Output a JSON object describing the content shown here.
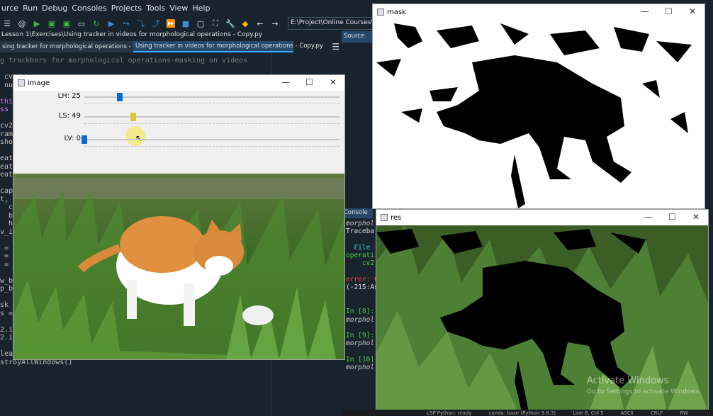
{
  "menubar": {
    "items": [
      "urce",
      "Run",
      "Debug",
      "Consoles",
      "Projects",
      "Tools",
      "View",
      "Help"
    ]
  },
  "toolbar": {
    "path_value": "E:\\Project\\Online Courses\\OpenCV"
  },
  "editor": {
    "file_path": "Lesson 1\\Exercises\\Using tracker in videos for morphological operations - Copy.py",
    "tabs": [
      {
        "label": "sing tracker for morphological operations - Copy.py",
        "active": false
      },
      {
        "label": "Using tracker in videos for morphological operations - Copy.py",
        "active": true
      }
    ],
    "lines": [
      "g trackbars for morphological operations-masking on videos",
      "",
      " cv",
      " num",
      "",
      "thin",
      "ss",
      "",
      "cv2",
      "ramc",
      "show",
      "",
      "eate",
      "eate",
      "eate",
      "",
      "cap",
      "t,",
      "  cv",
      "  b",
      "  h",
      "v_i",
      "",
      " =",
      " =",
      " =",
      "",
      "w_b",
      "p_b",
      "",
      "sk",
      "s =",
      "",
      "2.i",
      "2.i",
      "",
      "lea",
      "stroyAllWindows()"
    ]
  },
  "right_pane": {
    "source_tab": "Source",
    "console_tab": "Console",
    "console_lines": [
      {
        "text": "morphol",
        "color": "#c6c6c6",
        "italic": true
      },
      {
        "text": "Traceba",
        "color": "#e0e0e0",
        "italic": false
      },
      {
        "text": "",
        "color": "#e0e0e0",
        "italic": false
      },
      {
        "text": "  File",
        "color": "#42d0e6",
        "italic": false
      },
      {
        "text": "operati",
        "color": "#4ed34e",
        "italic": false
      },
      {
        "text": "    cv2",
        "color": "#4ed34e",
        "italic": false
      },
      {
        "text": "",
        "color": "#e0e0e0",
        "italic": false
      },
      {
        "text": "error: C",
        "color": "#ff4d4d",
        "italic": false
      },
      {
        "text": "(-215:As",
        "color": "#e0e0e0",
        "italic": false
      },
      {
        "text": "",
        "color": "#e0e0e0",
        "italic": false
      },
      {
        "text": "",
        "color": "#e0e0e0",
        "italic": false
      },
      {
        "text": "In [8]:",
        "color": "#4ed34e",
        "italic": false
      },
      {
        "text": "morphol",
        "color": "#c6c6c6",
        "italic": true
      },
      {
        "text": "",
        "color": "#e0e0e0",
        "italic": false
      },
      {
        "text": "In [9]:",
        "color": "#4ed34e",
        "italic": false
      },
      {
        "text": "morphol",
        "color": "#c6c6c6",
        "italic": true
      },
      {
        "text": "",
        "color": "#e0e0e0",
        "italic": false
      },
      {
        "text": "In [10]",
        "color": "#4ed34e",
        "italic": false
      },
      {
        "text": "morphol",
        "color": "#c6c6c6",
        "italic": true
      }
    ]
  },
  "windows": {
    "image": {
      "title": "image",
      "sliders": [
        {
          "label": "LH: 25",
          "value": 25,
          "max": 179
        },
        {
          "label": "LS: 49",
          "value": 49,
          "max": 255
        },
        {
          "label": "LV: 0",
          "value": 0,
          "max": 255
        }
      ]
    },
    "mask": {
      "title": "mask"
    },
    "res": {
      "title": "res"
    }
  },
  "window_controls": {
    "minimize": "—",
    "maximize": "☐",
    "close": "✕"
  },
  "statusbar": {
    "items": [
      "LSP Python: ready",
      "conda: base (Python 3.8.3)",
      "Line 8, Col 5",
      "ASCII",
      "CRLF",
      "RW"
    ]
  },
  "watermark": {
    "title": "Activate Windows",
    "subtitle": "Go to Settings to activate Windows."
  },
  "colors": {
    "accent": "#37aeff",
    "ide_bg": "#19232d",
    "thumb": "#0a6bd6"
  }
}
